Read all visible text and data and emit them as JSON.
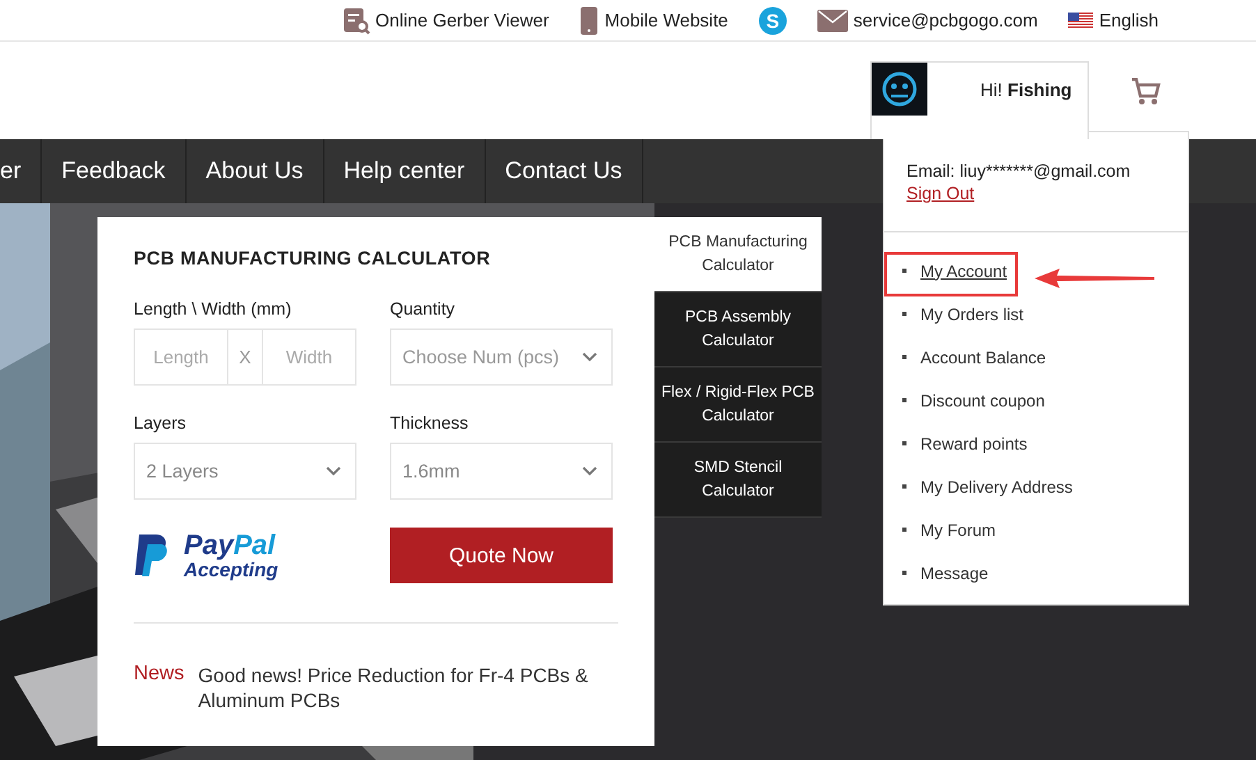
{
  "top_bar": {
    "links": [
      {
        "kind": "gerber",
        "label": "Online Gerber Viewer"
      },
      {
        "kind": "mobile",
        "label": "Mobile Website"
      },
      {
        "kind": "skype",
        "label": "S"
      },
      {
        "kind": "mail",
        "label": "service@pcbgogo.com"
      },
      {
        "kind": "flag",
        "label": "English"
      }
    ]
  },
  "user": {
    "greeting": "Hi!",
    "name": "Fishing",
    "email": "Email: liuy*******@gmail.com",
    "sign_out": "Sign Out",
    "menu": [
      {
        "label": "My Account",
        "selected": true
      },
      {
        "label": "My Orders list",
        "selected": false
      },
      {
        "label": "Account Balance",
        "selected": false
      },
      {
        "label": "Discount coupon",
        "selected": false
      },
      {
        "label": "Reward points",
        "selected": false
      },
      {
        "label": "My Delivery Address",
        "selected": false
      },
      {
        "label": "My Forum",
        "selected": false
      },
      {
        "label": "Message",
        "selected": false
      }
    ]
  },
  "nav": {
    "items": [
      "er",
      "Feedback",
      "About Us",
      "Help center",
      "Contact Us"
    ]
  },
  "calculator": {
    "title": "PCB MANUFACTURING CALCULATOR",
    "size": {
      "label": "Length \\ Width (mm)",
      "length_placeholder": "Length",
      "separator": "X",
      "width_placeholder": "Width"
    },
    "quantity": {
      "label": "Quantity",
      "placeholder": "Choose Num (pcs)"
    },
    "layers": {
      "label": "Layers",
      "value": "2 Layers"
    },
    "thickness": {
      "label": "Thickness",
      "value": "1.6mm"
    },
    "paypal": {
      "brand_first": "Pay",
      "brand_second": "Pal",
      "caption": "Accepting"
    },
    "quote_button": "Quote Now",
    "news": {
      "tag": "News",
      "title": "Good news! Price Reduction for Fr-4 PCBs & Aluminum PCBs"
    },
    "tabs": [
      {
        "label": "PCB Manufacturing Calculator",
        "selected": true
      },
      {
        "label": "PCB Assembly Calculator",
        "selected": false
      },
      {
        "label": "Flex / Rigid-Flex PCB Calculator",
        "selected": false
      },
      {
        "label": "SMD Stencil Calculator",
        "selected": false
      }
    ]
  }
}
